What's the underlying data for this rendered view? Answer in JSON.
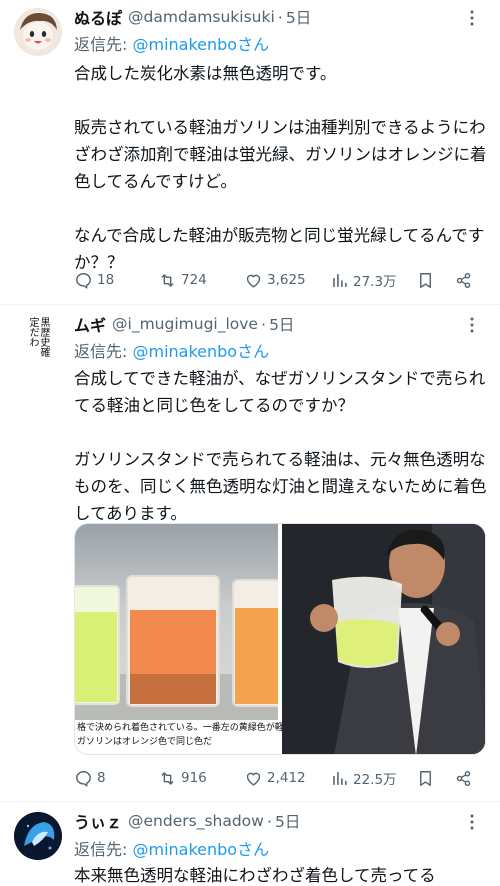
{
  "tweets": [
    {
      "name": "ぬるぽ",
      "handle": "@damdamsukisuki",
      "time": "5日",
      "reply_prefix": "返信先: ",
      "reply_to": "@minakenboさん",
      "body": "合成した炭化水素は無色透明です。\n\n販売されている軽油ガソリンは油種判別できるようにわざわざ添加剤で軽油は蛍光緑、ガソリンはオレンジに着色してるんですけど。\n\nなんで合成した軽油が販売物と同じ蛍光緑してるんですか？？",
      "stats": {
        "replies": "18",
        "retweets": "724",
        "likes": "3,625",
        "views": "27.3万"
      }
    },
    {
      "name": "ムギ",
      "handle": "@i_mugimugi_love",
      "time": "5日",
      "avatar_text": "黒歴史確定だわ",
      "reply_prefix": "返信先: ",
      "reply_to": "@minakenboさん",
      "body": "合成してできた軽油が、なぜガソリンスタンドで売られてる軽油と同じ色をしてるのですか？\n\nガソリンスタンドで売られてる軽油は、元々無色透明なものを、同じく無色透明な灯油と間違えないために着色してあります。",
      "image_caption_1": "格で決められ着色されている。一番左の黄緑色が軽油、中央の",
      "image_caption_2": "ガソリンはオレンジ色で同じ色だ",
      "stats": {
        "replies": "8",
        "retweets": "916",
        "likes": "2,412",
        "views": "22.5万"
      }
    },
    {
      "name": "うぃｚ",
      "handle": "@enders_shadow",
      "time": "5日",
      "reply_prefix": "返信先: ",
      "reply_to": "@minakenboさん",
      "body": "本来無色透明な軽油にわざわざ着色して売ってる"
    }
  ],
  "colors": {
    "accent": "#1d9bf0",
    "muted": "#536471",
    "text": "#0f1419"
  },
  "icons": [
    "more-icon",
    "reply-icon",
    "retweet-icon",
    "like-icon",
    "views-icon",
    "bookmark-icon",
    "share-icon"
  ]
}
